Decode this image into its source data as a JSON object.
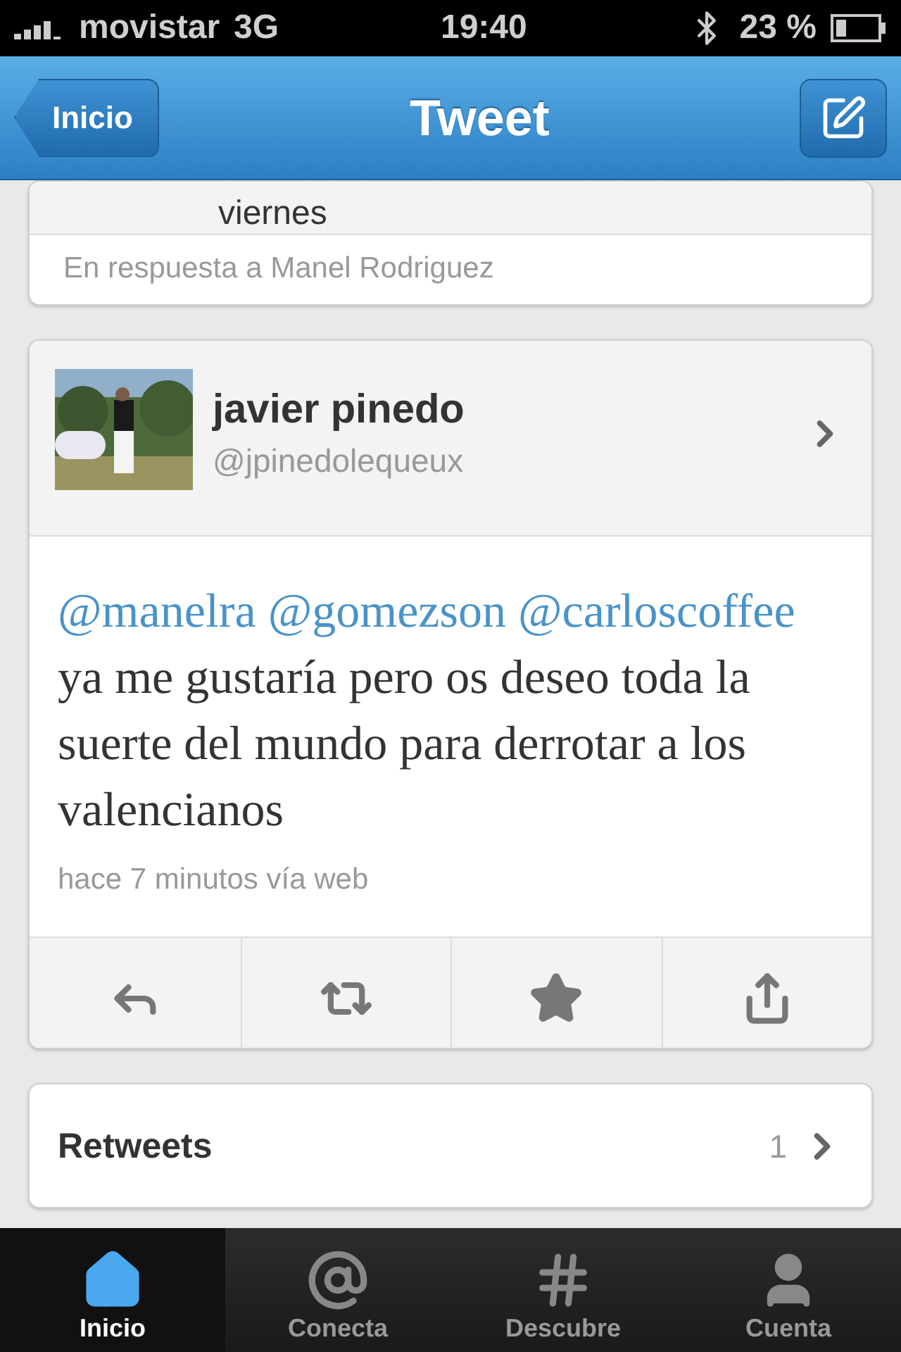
{
  "status_bar": {
    "carrier": "movistar",
    "network": "3G",
    "time": "19:40",
    "battery": "23 %"
  },
  "nav_bar": {
    "back": "Inicio",
    "title": "Tweet"
  },
  "previous_tweet": {
    "text_fragment": "viernes",
    "reply_note": "En respuesta a Manel Rodriguez"
  },
  "tweet": {
    "author": "javier pinedo",
    "handle": "@jpinedolequeux",
    "text": [
      {
        "kind": "mention",
        "text": "@manelra"
      },
      {
        "kind": "mention",
        "text": "@gomezson"
      },
      {
        "kind": "mention",
        "text": "@carloscoffee"
      },
      {
        "kind": "plain",
        "text": "ya me gustaría pero os deseo toda la suerte del mundo para derrotar a los valencianos"
      }
    ],
    "meta": "hace 7 minutos vía web",
    "actions": [
      {
        "kind": "reply"
      },
      {
        "kind": "retweet"
      },
      {
        "kind": "favorite"
      },
      {
        "kind": "share"
      }
    ]
  },
  "retweets": {
    "label": "Retweets",
    "count": "1"
  },
  "tab_bar": [
    {
      "label": "Inicio",
      "kind": "home",
      "selected": true
    },
    {
      "label": "Conecta",
      "kind": "at",
      "selected": false
    },
    {
      "label": "Descubre",
      "kind": "hash",
      "selected": false
    },
    {
      "label": "Cuenta",
      "kind": "person",
      "selected": false
    }
  ]
}
